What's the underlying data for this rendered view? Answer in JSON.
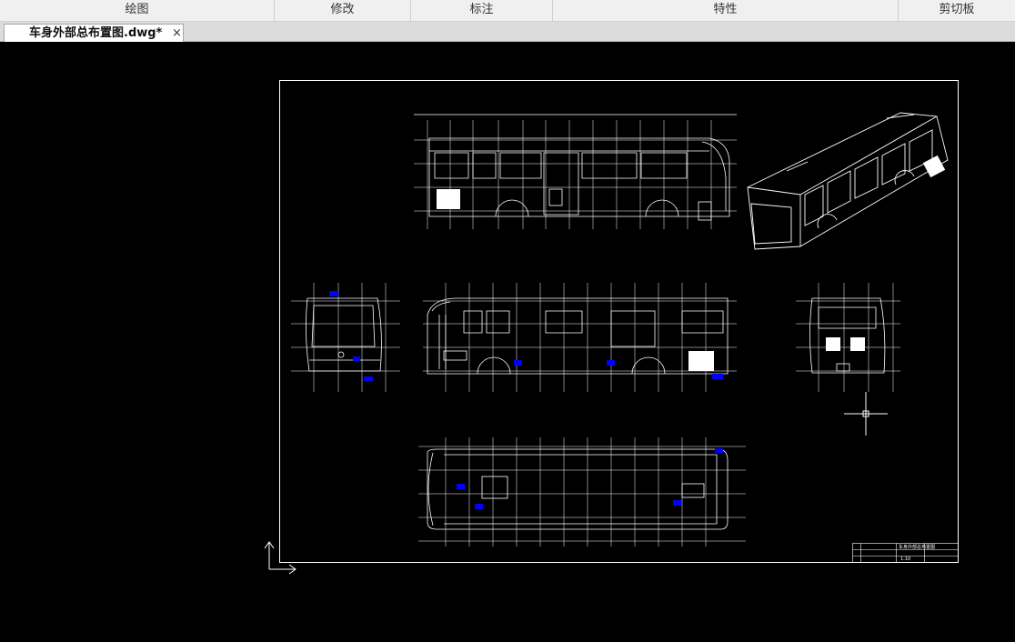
{
  "ribbon": {
    "groups": [
      {
        "label": "绘图"
      },
      {
        "label": "修改"
      },
      {
        "label": "标注"
      },
      {
        "label": "特性"
      },
      {
        "label": "剪切板"
      }
    ]
  },
  "document_tab": {
    "title": "车身外部总布置图.dwg*",
    "close_glyph": "×"
  },
  "drawing": {
    "title_block": {
      "name": "车身外部总布置图",
      "scale": "1:10"
    }
  },
  "colors": {
    "canvas_background": "#000000",
    "line_color": "#ffffff",
    "dimension_color": "#0000ff",
    "ribbon_background": "#f0f0f0"
  },
  "icons": {
    "ucs": "ucs-axis-icon",
    "cursor": "crosshair-cursor-icon",
    "close": "close-icon"
  }
}
